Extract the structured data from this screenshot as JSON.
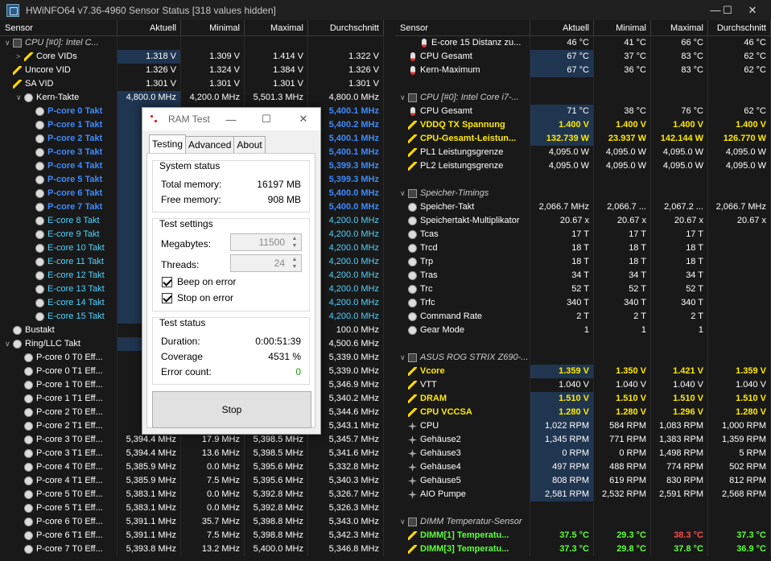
{
  "window": {
    "title": "HWiNFO64 v7.36-4960 Sensor Status [318 values hidden]",
    "min": "—",
    "max": "☐",
    "close": "✕"
  },
  "columns": {
    "sensor": "Sensor",
    "current": "Aktuell",
    "min": "Minimal",
    "max": "Maximal",
    "avg": "Durchschnitt"
  },
  "left_rows": [
    {
      "type": "group",
      "icon": "chip",
      "tw": "∨",
      "name": "CPU [#0]: Intel C...",
      "cur": "",
      "min": "",
      "max": "",
      "avg": ""
    },
    {
      "icon": "bolt",
      "tw": ">",
      "ind": 1,
      "name": "Core VIDs",
      "cur": "1.318 V",
      "min": "1.309 V",
      "max": "1.414 V",
      "avg": "1.322 V",
      "sel": true
    },
    {
      "icon": "bolt",
      "ind": 0,
      "name": "Uncore VID",
      "cur": "1.326 V",
      "min": "1.324 V",
      "max": "1.384 V",
      "avg": "1.326 V"
    },
    {
      "icon": "bolt",
      "ind": 0,
      "name": "SA VID",
      "cur": "1.301 V",
      "min": "1.301 V",
      "max": "1.301 V",
      "avg": "1.301 V"
    },
    {
      "icon": "clock",
      "tw": "∨",
      "ind": 1,
      "name": "Kern-Takte",
      "cur": "4,800.0 MHz",
      "min": "4,200.0 MHz",
      "max": "5,501.3 MHz",
      "avg": "4,800.0 MHz",
      "sel": true
    },
    {
      "icon": "clock",
      "ind": 2,
      "cls": "blue",
      "name": "P-core 0 Takt",
      "cur": "5,40",
      "min": "",
      "max": "",
      "avg": "5,400.1 MHz",
      "sel": true
    },
    {
      "icon": "clock",
      "ind": 2,
      "cls": "blue",
      "name": "P-core 1 Takt",
      "cur": "5,40",
      "min": "",
      "max": "",
      "avg": "5,400.2 MHz",
      "sel": true
    },
    {
      "icon": "clock",
      "ind": 2,
      "cls": "blue",
      "name": "P-core 2 Takt",
      "cur": "5,40",
      "min": "",
      "max": "",
      "avg": "5,400.1 MHz",
      "sel": true
    },
    {
      "icon": "clock",
      "ind": 2,
      "cls": "blue",
      "name": "P-core 3 Takt",
      "cur": "5,40",
      "min": "",
      "max": "",
      "avg": "5,400.1 MHz",
      "sel": true
    },
    {
      "icon": "clock",
      "ind": 2,
      "cls": "blue",
      "name": "P-core 4 Takt",
      "cur": "5,40",
      "min": "",
      "max": "",
      "avg": "5,399.3 MHz",
      "sel": true
    },
    {
      "icon": "clock",
      "ind": 2,
      "cls": "blue",
      "name": "P-core 5 Takt",
      "cur": "5,40",
      "min": "",
      "max": "",
      "avg": "5,399.3 MHz",
      "sel": true
    },
    {
      "icon": "clock",
      "ind": 2,
      "cls": "blue",
      "name": "P-core 6 Takt",
      "cur": "5,40",
      "min": "",
      "max": "",
      "avg": "5,400.0 MHz",
      "sel": true
    },
    {
      "icon": "clock",
      "ind": 2,
      "cls": "blue",
      "name": "P-core 7 Takt",
      "cur": "5,40",
      "min": "",
      "max": "",
      "avg": "5,400.0 MHz",
      "sel": true
    },
    {
      "icon": "clock",
      "ind": 2,
      "cls": "teal",
      "name": "E-core 8 Takt",
      "cur": "4,20",
      "min": "",
      "max": "",
      "avg": "4,200.0 MHz",
      "sel": true
    },
    {
      "icon": "clock",
      "ind": 2,
      "cls": "teal",
      "name": "E-core 9 Takt",
      "cur": "4,20",
      "min": "",
      "max": "",
      "avg": "4,200.0 MHz",
      "sel": true
    },
    {
      "icon": "clock",
      "ind": 2,
      "cls": "teal",
      "name": "E-core 10 Takt",
      "cur": "4,20",
      "min": "",
      "max": "",
      "avg": "4,200.0 MHz",
      "sel": true
    },
    {
      "icon": "clock",
      "ind": 2,
      "cls": "teal",
      "name": "E-core 11 Takt",
      "cur": "4,20",
      "min": "",
      "max": "",
      "avg": "4,200.0 MHz",
      "sel": true
    },
    {
      "icon": "clock",
      "ind": 2,
      "cls": "teal",
      "name": "E-core 12 Takt",
      "cur": "4,20",
      "min": "",
      "max": "",
      "avg": "4,200.0 MHz",
      "sel": true
    },
    {
      "icon": "clock",
      "ind": 2,
      "cls": "teal",
      "name": "E-core 13 Takt",
      "cur": "4,20",
      "min": "",
      "max": "",
      "avg": "4,200.0 MHz",
      "sel": true
    },
    {
      "icon": "clock",
      "ind": 2,
      "cls": "teal",
      "name": "E-core 14 Takt",
      "cur": "4,20",
      "min": "",
      "max": "",
      "avg": "4,200.0 MHz",
      "sel": true
    },
    {
      "icon": "clock",
      "ind": 2,
      "cls": "teal",
      "name": "E-core 15 Takt",
      "cur": "4,20",
      "min": "",
      "max": "",
      "avg": "4,200.0 MHz",
      "sel": true
    },
    {
      "icon": "clock",
      "ind": 0,
      "name": "Bustakt",
      "cur": "10",
      "min": "",
      "max": "",
      "avg": "100.0 MHz"
    },
    {
      "icon": "clock",
      "tw": "∨",
      "ind": 0,
      "name": "Ring/LLC Takt",
      "cur": "4,50",
      "min": "",
      "max": "",
      "avg": "4,500.6 MHz",
      "sel": true
    },
    {
      "icon": "clock",
      "ind": 1,
      "name": "P-core 0 T0 Eff...",
      "cur": "5,39",
      "min": "",
      "max": "",
      "avg": "5,339.0 MHz"
    },
    {
      "icon": "clock",
      "ind": 1,
      "name": "P-core 0 T1 Eff...",
      "cur": "5,39",
      "min": "",
      "max": "",
      "avg": "5,339.0 MHz"
    },
    {
      "icon": "clock",
      "ind": 1,
      "name": "P-core 1 T0 Eff...",
      "cur": "5,39",
      "min": "",
      "max": "",
      "avg": "5,346.9 MHz"
    },
    {
      "icon": "clock",
      "ind": 1,
      "name": "P-core 1 T1 Eff...",
      "cur": "5,39",
      "min": "",
      "max": "",
      "avg": "5,340.2 MHz"
    },
    {
      "icon": "clock",
      "ind": 1,
      "name": "P-core 2 T0 Eff...",
      "cur": "5,39",
      "min": "",
      "max": "",
      "avg": "5,344.6 MHz"
    },
    {
      "icon": "clock",
      "ind": 1,
      "name": "P-core 2 T1 Eff...",
      "cur": "5,39",
      "min": "",
      "max": "",
      "avg": "5,343.1 MHz"
    },
    {
      "icon": "clock",
      "ind": 1,
      "name": "P-core 3 T0 Eff...",
      "cur": "5,394.4 MHz",
      "min": "17.9 MHz",
      "max": "5,398.5 MHz",
      "avg": "5,345.7 MHz"
    },
    {
      "icon": "clock",
      "ind": 1,
      "name": "P-core 3 T1 Eff...",
      "cur": "5,394.4 MHz",
      "min": "13.6 MHz",
      "max": "5,398.5 MHz",
      "avg": "5,341.6 MHz"
    },
    {
      "icon": "clock",
      "ind": 1,
      "name": "P-core 4 T0 Eff...",
      "cur": "5,385.9 MHz",
      "min": "0.0 MHz",
      "max": "5,395.6 MHz",
      "avg": "5,332.8 MHz"
    },
    {
      "icon": "clock",
      "ind": 1,
      "name": "P-core 4 T1 Eff...",
      "cur": "5,385.9 MHz",
      "min": "7.5 MHz",
      "max": "5,395.6 MHz",
      "avg": "5,340.3 MHz"
    },
    {
      "icon": "clock",
      "ind": 1,
      "name": "P-core 5 T0 Eff...",
      "cur": "5,383.1 MHz",
      "min": "0.0 MHz",
      "max": "5,392.8 MHz",
      "avg": "5,326.7 MHz"
    },
    {
      "icon": "clock",
      "ind": 1,
      "name": "P-core 5 T1 Eff...",
      "cur": "5,383.1 MHz",
      "min": "0.0 MHz",
      "max": "5,392.8 MHz",
      "avg": "5,326.3 MHz"
    },
    {
      "icon": "clock",
      "ind": 1,
      "name": "P-core 6 T0 Eff...",
      "cur": "5,391.1 MHz",
      "min": "35.7 MHz",
      "max": "5,398.8 MHz",
      "avg": "5,343.0 MHz"
    },
    {
      "icon": "clock",
      "ind": 1,
      "name": "P-core 6 T1 Eff...",
      "cur": "5,391.1 MHz",
      "min": "7.5 MHz",
      "max": "5,398.8 MHz",
      "avg": "5,342.3 MHz"
    },
    {
      "icon": "clock",
      "ind": 1,
      "name": "P-core 7 T0 Eff...",
      "cur": "5,393.8 MHz",
      "min": "13.2 MHz",
      "max": "5,400.0 MHz",
      "avg": "5,346.8 MHz"
    }
  ],
  "right_rows": [
    {
      "icon": "therm",
      "ind": 1,
      "name": "E-core 15 Distanz zu...",
      "cur": "46 °C",
      "min": "41 °C",
      "max": "66 °C",
      "avg": "46 °C"
    },
    {
      "icon": "therm",
      "ind": 0,
      "name": "CPU Gesamt",
      "cur": "67 °C",
      "min": "37 °C",
      "max": "83 °C",
      "avg": "62 °C",
      "sel": true
    },
    {
      "icon": "therm",
      "ind": 0,
      "name": "Kern-Maximum",
      "cur": "67 °C",
      "min": "36 °C",
      "max": "83 °C",
      "avg": "62 °C",
      "sel": true
    },
    {
      "type": "blank",
      "name": "",
      "cur": "",
      "min": "",
      "max": "",
      "avg": ""
    },
    {
      "type": "group",
      "icon": "chip",
      "tw": "∨",
      "name": "CPU [#0]: Intel Core i7-...",
      "cur": "",
      "min": "",
      "max": "",
      "avg": ""
    },
    {
      "icon": "therm",
      "ind": 0,
      "name": "CPU Gesamt",
      "cur": "71 °C",
      "min": "38 °C",
      "max": "76 °C",
      "avg": "62 °C",
      "sel": true
    },
    {
      "icon": "bolt",
      "ind": 0,
      "cls": "yellow",
      "name": "VDDQ TX Spannung",
      "cur": "1.400 V",
      "min": "1.400 V",
      "max": "1.400 V",
      "avg": "1.400 V",
      "sel": true
    },
    {
      "icon": "bolt",
      "ind": 0,
      "cls": "yellow",
      "name": "CPU-Gesamt-Leistun...",
      "cur": "132.739 W",
      "min": "23.937 W",
      "max": "142.144 W",
      "avg": "126.770 W",
      "sel": true
    },
    {
      "icon": "bolt",
      "ind": 0,
      "name": "PL1 Leistungsgrenze",
      "cur": "4,095.0 W",
      "min": "4,095.0 W",
      "max": "4,095.0 W",
      "avg": "4,095.0 W"
    },
    {
      "icon": "bolt",
      "ind": 0,
      "name": "PL2 Leistungsgrenze",
      "cur": "4,095.0 W",
      "min": "4,095.0 W",
      "max": "4,095.0 W",
      "avg": "4,095.0 W"
    },
    {
      "type": "blank",
      "name": "",
      "cur": "",
      "min": "",
      "max": "",
      "avg": ""
    },
    {
      "type": "group",
      "icon": "chip",
      "tw": "∨",
      "name": "Speicher-Timings",
      "cur": "",
      "min": "",
      "max": "",
      "avg": ""
    },
    {
      "icon": "clock",
      "ind": 0,
      "name": "Speicher-Takt",
      "cur": "2,066.7 MHz",
      "min": "2,066.7 ...",
      "max": "2,067.2 ...",
      "avg": "2,066.7 MHz"
    },
    {
      "icon": "clock",
      "ind": 0,
      "name": "Speichertakt-Multiplikator",
      "cur": "20.67 x",
      "min": "20.67 x",
      "max": "20.67 x",
      "avg": "20.67 x"
    },
    {
      "icon": "clock",
      "ind": 0,
      "name": "Tcas",
      "cur": "17 T",
      "min": "17 T",
      "max": "17 T",
      "avg": ""
    },
    {
      "icon": "clock",
      "ind": 0,
      "name": "Trcd",
      "cur": "18 T",
      "min": "18 T",
      "max": "18 T",
      "avg": ""
    },
    {
      "icon": "clock",
      "ind": 0,
      "name": "Trp",
      "cur": "18 T",
      "min": "18 T",
      "max": "18 T",
      "avg": ""
    },
    {
      "icon": "clock",
      "ind": 0,
      "name": "Tras",
      "cur": "34 T",
      "min": "34 T",
      "max": "34 T",
      "avg": ""
    },
    {
      "icon": "clock",
      "ind": 0,
      "name": "Trc",
      "cur": "52 T",
      "min": "52 T",
      "max": "52 T",
      "avg": ""
    },
    {
      "icon": "clock",
      "ind": 0,
      "name": "Trfc",
      "cur": "340 T",
      "min": "340 T",
      "max": "340 T",
      "avg": ""
    },
    {
      "icon": "clock",
      "ind": 0,
      "name": "Command Rate",
      "cur": "2 T",
      "min": "2 T",
      "max": "2 T",
      "avg": ""
    },
    {
      "icon": "clock",
      "ind": 0,
      "name": "Gear Mode",
      "cur": "1",
      "min": "1",
      "max": "1",
      "avg": ""
    },
    {
      "type": "blank",
      "name": "",
      "cur": "",
      "min": "",
      "max": "",
      "avg": ""
    },
    {
      "type": "group",
      "icon": "chip",
      "tw": "∨",
      "name": "ASUS ROG STRIX Z690-...",
      "cur": "",
      "min": "",
      "max": "",
      "avg": ""
    },
    {
      "icon": "bolt",
      "ind": 0,
      "cls": "yellow",
      "name": "Vcore",
      "cur": "1.359 V",
      "min": "1.350 V",
      "max": "1.421 V",
      "avg": "1.359 V",
      "sel": true
    },
    {
      "icon": "bolt",
      "ind": 0,
      "name": "VTT",
      "cur": "1.040 V",
      "min": "1.040 V",
      "max": "1.040 V",
      "avg": "1.040 V"
    },
    {
      "icon": "bolt",
      "ind": 0,
      "cls": "yellow",
      "name": "DRAM",
      "cur": "1.510 V",
      "min": "1.510 V",
      "max": "1.510 V",
      "avg": "1.510 V",
      "sel": true
    },
    {
      "icon": "bolt",
      "ind": 0,
      "cls": "yellow",
      "name": "CPU VCCSA",
      "cur": "1.280 V",
      "min": "1.280 V",
      "max": "1.296 V",
      "avg": "1.280 V",
      "sel": true
    },
    {
      "icon": "fan",
      "ind": 0,
      "name": "CPU",
      "cur": "1,022 RPM",
      "min": "584 RPM",
      "max": "1,083 RPM",
      "avg": "1,000 RPM",
      "sel": true
    },
    {
      "icon": "fan",
      "ind": 0,
      "name": "Gehäuse2",
      "cur": "1,345 RPM",
      "min": "771 RPM",
      "max": "1,383 RPM",
      "avg": "1,359 RPM",
      "sel": true
    },
    {
      "icon": "fan",
      "ind": 0,
      "name": "Gehäuse3",
      "cur": "0 RPM",
      "min": "0 RPM",
      "max": "1,498 RPM",
      "avg": "5 RPM",
      "sel": true
    },
    {
      "icon": "fan",
      "ind": 0,
      "name": "Gehäuse4",
      "cur": "497 RPM",
      "min": "488 RPM",
      "max": "774 RPM",
      "avg": "502 RPM",
      "sel": true
    },
    {
      "icon": "fan",
      "ind": 0,
      "name": "Gehäuse5",
      "cur": "808 RPM",
      "min": "619 RPM",
      "max": "830 RPM",
      "avg": "812 RPM",
      "sel": true
    },
    {
      "icon": "fan",
      "ind": 0,
      "name": "AIO Pumpe",
      "cur": "2,581 RPM",
      "min": "2,532 RPM",
      "max": "2,591 RPM",
      "avg": "2,568 RPM",
      "sel": true
    },
    {
      "type": "blank",
      "name": "",
      "cur": "",
      "min": "",
      "max": "",
      "avg": ""
    },
    {
      "type": "group",
      "icon": "chip",
      "tw": "∨",
      "name": "DIMM Temperatur-Sensor",
      "cur": "",
      "min": "",
      "max": "",
      "avg": ""
    },
    {
      "icon": "bolt",
      "ind": 0,
      "cls": "green",
      "name": "DIMM[1] Temperatu...",
      "cur": "37.5 °C",
      "min": "29.3 °C",
      "max": "38.3 °C",
      "avg": "37.3 °C",
      "maxRed": true
    },
    {
      "icon": "bolt",
      "ind": 0,
      "cls": "green",
      "name": "DIMM[3] Temperatu...",
      "cur": "37.3 °C",
      "min": "29.8 °C",
      "max": "37.8 °C",
      "avg": "36.9 °C"
    }
  ],
  "dialog": {
    "title": "RAM Test",
    "tabs": [
      "Testing",
      "Advanced",
      "About"
    ],
    "system_status": {
      "title": "System status",
      "total_label": "Total memory:",
      "total_value": "16197 MB",
      "free_label": "Free memory:",
      "free_value": "908 MB"
    },
    "test_settings": {
      "title": "Test settings",
      "mb_label": "Megabytes:",
      "mb_value": "11500",
      "threads_label": "Threads:",
      "threads_value": "24",
      "beep_label": "Beep on error",
      "stop_label": "Stop on error"
    },
    "test_status": {
      "title": "Test status",
      "duration_label": "Duration:",
      "duration_value": "0:00:51:39",
      "coverage_label": "Coverage",
      "coverage_value": "4531 %",
      "errors_label": "Error count:",
      "errors_value": "0"
    },
    "stop_button": "Stop"
  }
}
